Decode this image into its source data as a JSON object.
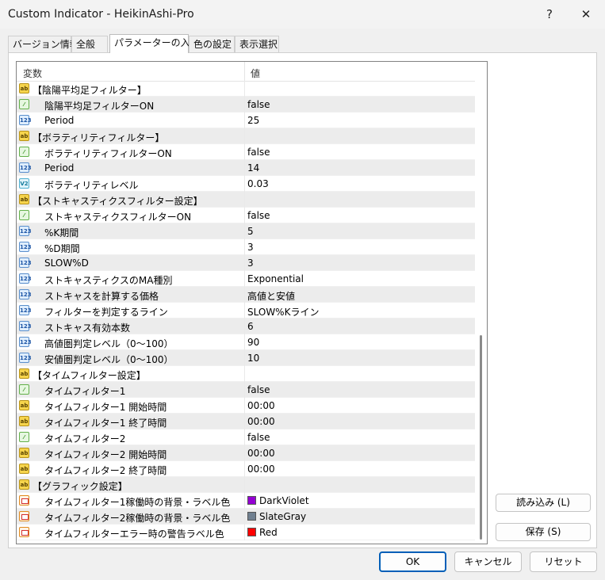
{
  "window": {
    "title": "Custom Indicator - HeikinAshi-Pro",
    "help": "?",
    "close": "✕"
  },
  "tabs": [
    "バージョン情報",
    "全般",
    "パラメーターの入力",
    "色の設定",
    "表示選択"
  ],
  "grid": {
    "col_var": "変数",
    "col_val": "値",
    "rows": [
      {
        "icon": "ab",
        "name": "【陰陽平均足フィルター】",
        "value": "",
        "section": true
      },
      {
        "icon": "bool",
        "name": "陰陽平均足フィルターON",
        "value": "false"
      },
      {
        "icon": "int",
        "name": "Period",
        "value": "25"
      },
      {
        "icon": "ab",
        "name": "【ボラティリティフィルター】",
        "value": "",
        "section": true
      },
      {
        "icon": "bool",
        "name": "ボラティリティフィルターON",
        "value": "false"
      },
      {
        "icon": "int",
        "name": "Period",
        "value": "14"
      },
      {
        "icon": "dbl",
        "name": "ボラティリティレベル",
        "value": "0.03"
      },
      {
        "icon": "ab",
        "name": "【ストキャスティクスフィルター設定】",
        "value": "",
        "section": true
      },
      {
        "icon": "bool",
        "name": "ストキャスティクスフィルターON",
        "value": "false"
      },
      {
        "icon": "int",
        "name": "%K期間",
        "value": "5"
      },
      {
        "icon": "int",
        "name": "%D期間",
        "value": "3"
      },
      {
        "icon": "int",
        "name": "SLOW%D",
        "value": "3"
      },
      {
        "icon": "int",
        "name": "ストキャスティクスのMA種別",
        "value": "Exponential"
      },
      {
        "icon": "int",
        "name": "ストキャスを計算する価格",
        "value": "高値と安値"
      },
      {
        "icon": "int",
        "name": "フィルターを判定するライン",
        "value": "SLOW%Kライン"
      },
      {
        "icon": "int",
        "name": "ストキャス有効本数",
        "value": "6"
      },
      {
        "icon": "int",
        "name": "高値圏判定レベル（0〜100）",
        "value": "90"
      },
      {
        "icon": "int",
        "name": "安値圏判定レベル（0〜100）",
        "value": "10"
      },
      {
        "icon": "ab",
        "name": "【タイムフィルター設定】",
        "value": "",
        "section": true
      },
      {
        "icon": "bool",
        "name": "タイムフィルター1",
        "value": "false"
      },
      {
        "icon": "ab",
        "name": "タイムフィルター1 開始時間",
        "value": "00:00"
      },
      {
        "icon": "ab",
        "name": "タイムフィルター1 終了時間",
        "value": "00:00"
      },
      {
        "icon": "bool",
        "name": "タイムフィルター2",
        "value": "false"
      },
      {
        "icon": "ab",
        "name": "タイムフィルター2 開始時間",
        "value": "00:00"
      },
      {
        "icon": "ab",
        "name": "タイムフィルター2 終了時間",
        "value": "00:00"
      },
      {
        "icon": "ab",
        "name": "【グラフィック設定】",
        "value": "",
        "section": true
      },
      {
        "icon": "clr",
        "name": "タイムフィルター1稼働時の背景・ラベル色",
        "value": "DarkViolet",
        "swatch": "#9400d3"
      },
      {
        "icon": "clr",
        "name": "タイムフィルター2稼働時の背景・ラベル色",
        "value": "SlateGray",
        "swatch": "#708090"
      },
      {
        "icon": "clr",
        "name": "タイムフィルターエラー時の警告ラベル色",
        "value": "Red",
        "swatch": "#ff0000"
      }
    ]
  },
  "side_buttons": {
    "load": "読み込み (L)",
    "save": "保存 (S)"
  },
  "footer": {
    "ok": "OK",
    "cancel": "キャンセル",
    "reset": "リセット"
  }
}
